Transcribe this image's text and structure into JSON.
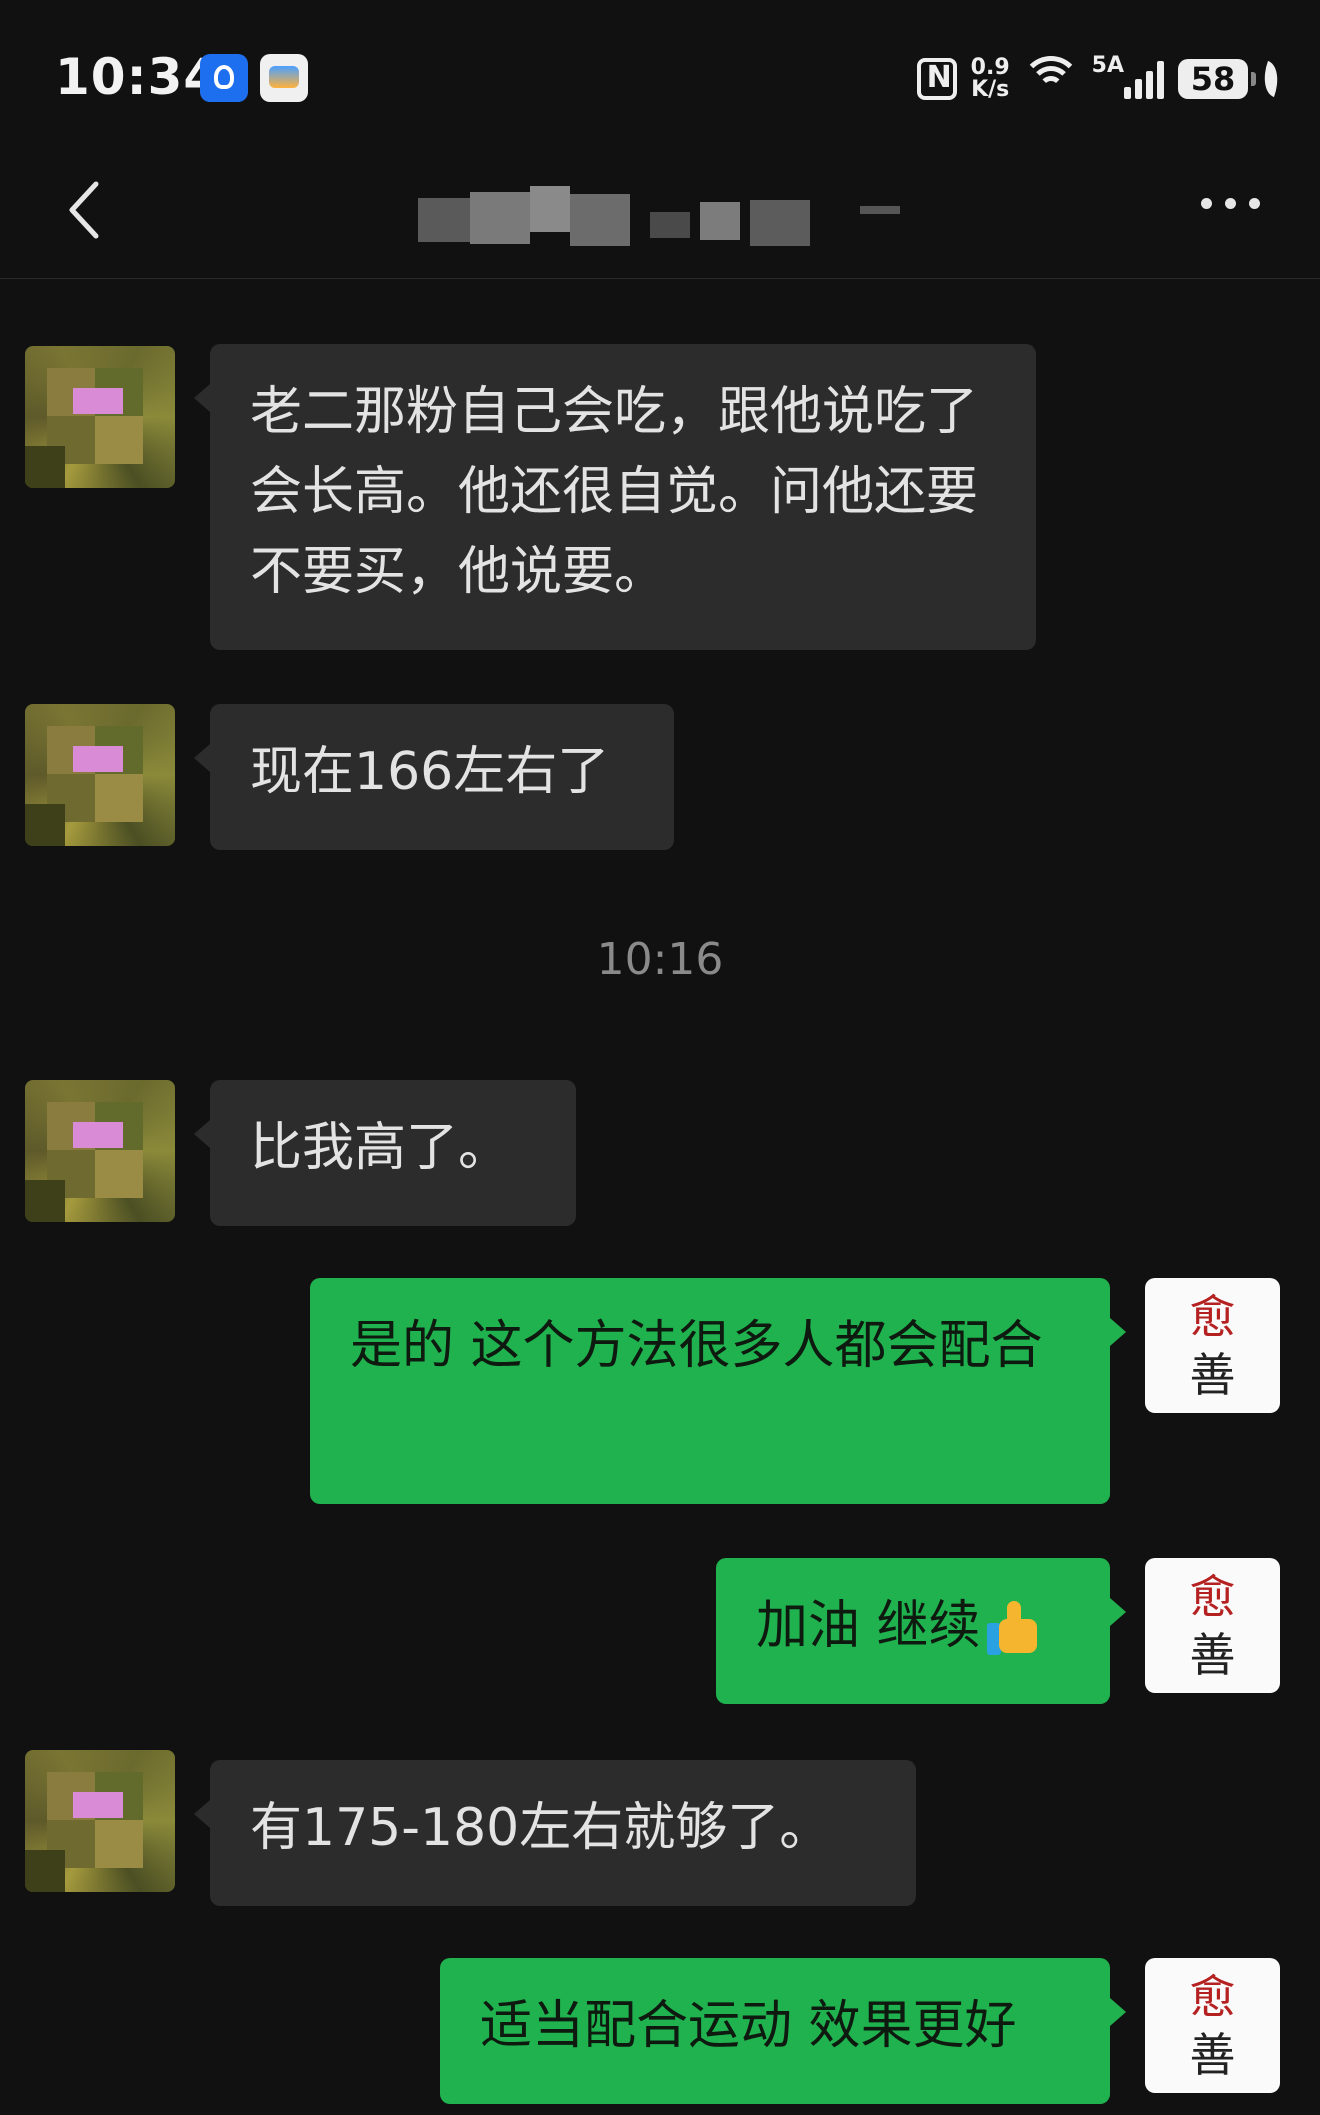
{
  "status_bar": {
    "time": "10:34",
    "net_speed_value": "0.9",
    "net_speed_unit": "K/s",
    "signal_label": "5A",
    "battery": "58"
  },
  "nav": {
    "title_blurred": true,
    "icons": [
      "back-icon",
      "more-icon"
    ]
  },
  "messages": [
    {
      "side": "in",
      "text": "老二那粉自己会吃，跟他说吃了会长高。他还很自觉。问他还要不要买，他说要。"
    },
    {
      "side": "in",
      "text": "现在166左右了"
    },
    {
      "type": "time",
      "text": "10:16"
    },
    {
      "side": "in",
      "text": "比我高了。"
    },
    {
      "side": "out",
      "text": "是的  这个方法很多人都会配合"
    },
    {
      "side": "out",
      "text": "加油 继续",
      "emoji": "thumbs-up"
    },
    {
      "side": "in",
      "text": "有175-180左右就够了。"
    },
    {
      "side": "out",
      "text": "适当配合运动 效果更好"
    }
  ],
  "self_avatar": {
    "char1": "愈",
    "char2": "善"
  },
  "colors": {
    "background": "#111111",
    "incoming_bubble": "#2c2c2c",
    "outgoing_bubble": "#1fb24e",
    "timestamp": "#8a8a8a"
  }
}
